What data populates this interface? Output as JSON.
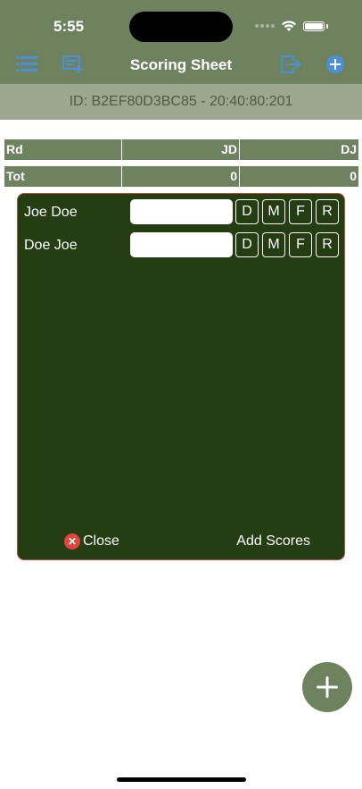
{
  "status": {
    "time": "5:55"
  },
  "nav": {
    "title": "Scoring Sheet",
    "icons": [
      "list-icon",
      "add-sheet-icon",
      "exit-icon",
      "add-circle-icon"
    ],
    "accent": "#4a90d9"
  },
  "session": {
    "id_text": "ID:  B2EF80D3BC85 -  20:40:80:201"
  },
  "table": {
    "header": [
      "Rd",
      "JD",
      "DJ"
    ],
    "total": [
      "Tot",
      "0",
      "0"
    ]
  },
  "modal": {
    "players": [
      {
        "name": "Joe Doe",
        "score": ""
      },
      {
        "name": "Doe Joe",
        "score": ""
      }
    ],
    "letter_buttons": [
      "D",
      "M",
      "F",
      "R"
    ],
    "close_label": "Close",
    "add_scores_label": "Add Scores"
  },
  "colors": {
    "header_green": "#6f8260",
    "id_bar": "#9ba78e",
    "modal_bg": "#243d12",
    "modal_border": "#c0473a",
    "close_red": "#e0443e"
  }
}
